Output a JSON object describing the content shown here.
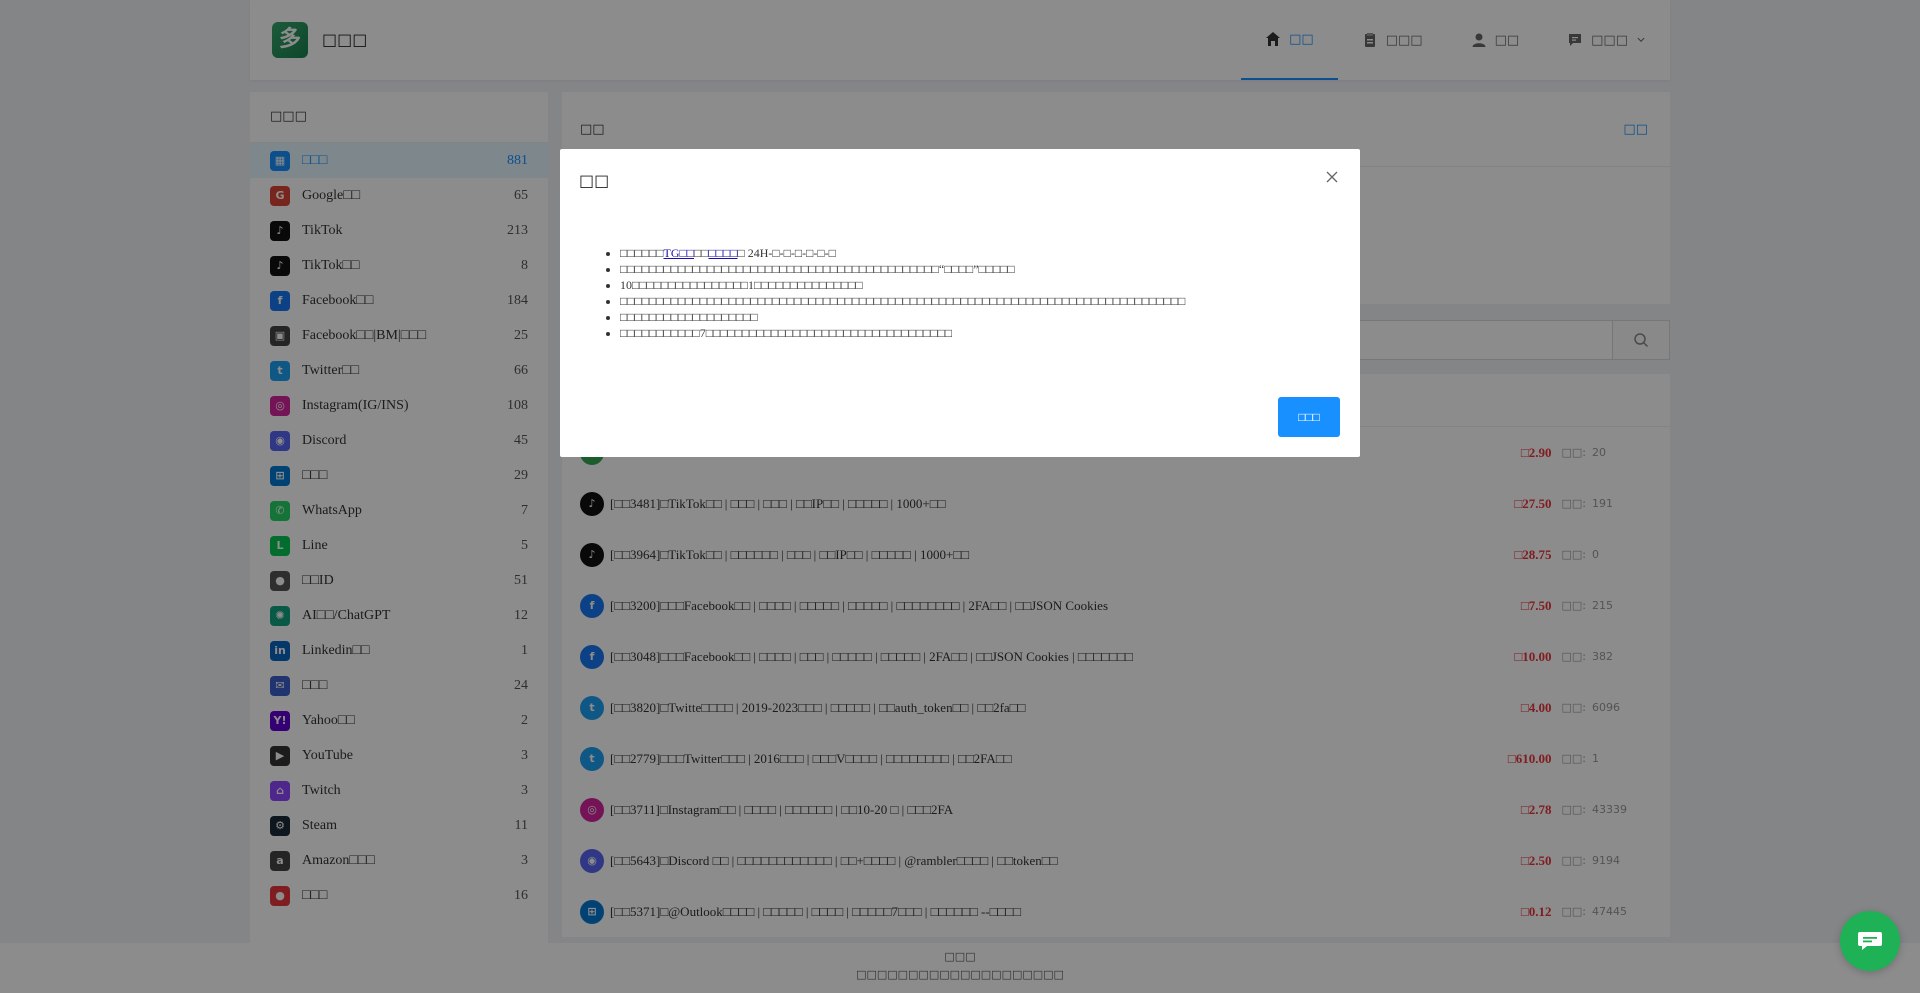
{
  "site": {
    "name": "□□□",
    "logo_char": "多"
  },
  "nav": [
    {
      "label": "□□",
      "icon": "home-icon",
      "active": true
    },
    {
      "label": "□□□",
      "icon": "clipboard-icon",
      "active": false
    },
    {
      "label": "□□",
      "icon": "user-icon",
      "active": false
    },
    {
      "label": "□□□",
      "icon": "chat-icon",
      "active": false,
      "dropdown": true
    }
  ],
  "sidebar": {
    "title": "□□□",
    "items": [
      {
        "label": "□□□",
        "count": "881",
        "icon": "grid-icon",
        "color": "#1890ff",
        "active": true
      },
      {
        "label": "Google□□",
        "count": "65",
        "icon": "chrome-icon",
        "color": "#db4437"
      },
      {
        "label": "TikTok",
        "count": "213",
        "icon": "tiktok-icon",
        "color": "#111111"
      },
      {
        "label": "TikTok□□",
        "count": "8",
        "icon": "tiktok-icon",
        "color": "#111111"
      },
      {
        "label": "Facebook□□",
        "count": "184",
        "icon": "facebook-icon",
        "color": "#1877f2"
      },
      {
        "label": "Facebook□□|BM|□□□",
        "count": "25",
        "icon": "image-icon",
        "color": "#444444"
      },
      {
        "label": "Twitter□□",
        "count": "66",
        "icon": "twitter-icon",
        "color": "#1da1f2"
      },
      {
        "label": "Instagram(IG/INS)",
        "count": "108",
        "icon": "instagram-icon",
        "color": "#d6249f"
      },
      {
        "label": "Discord",
        "count": "45",
        "icon": "discord-icon",
        "color": "#5865f2"
      },
      {
        "label": "□□□",
        "count": "29",
        "icon": "windows-icon",
        "color": "#0078d4"
      },
      {
        "label": "WhatsApp",
        "count": "7",
        "icon": "whatsapp-icon",
        "color": "#25d366"
      },
      {
        "label": "Line",
        "count": "5",
        "icon": "line-icon",
        "color": "#06c755"
      },
      {
        "label": "□□ID",
        "count": "51",
        "icon": "apple-icon",
        "color": "#555555"
      },
      {
        "label": "AI□□/ChatGPT",
        "count": "12",
        "icon": "openai-icon",
        "color": "#10a37f"
      },
      {
        "label": "Linkedin□□",
        "count": "1",
        "icon": "linkedin-icon",
        "color": "#0a66c2"
      },
      {
        "label": "□□□",
        "count": "24",
        "icon": "mail-icon",
        "color": "#3b5fcc"
      },
      {
        "label": "Yahoo□□",
        "count": "2",
        "icon": "yahoo-icon",
        "color": "#6001d2"
      },
      {
        "label": "YouTube",
        "count": "3",
        "icon": "youtube-icon",
        "color": "#333333"
      },
      {
        "label": "Twitch",
        "count": "3",
        "icon": "twitch-icon",
        "color": "#9146ff"
      },
      {
        "label": "Steam",
        "count": "11",
        "icon": "steam-icon",
        "color": "#1b2838"
      },
      {
        "label": "Amazon□□□",
        "count": "3",
        "icon": "amazon-icon",
        "color": "#444444"
      },
      {
        "label": "□□□",
        "count": "16",
        "icon": "person-icon",
        "color": "#e8353d"
      }
    ]
  },
  "notice": {
    "title": "□□",
    "more": "□□"
  },
  "search": {
    "placeholder": ""
  },
  "products": [
    {
      "name": "",
      "price": "□2.90",
      "stock_label": "□□:",
      "stock": "20",
      "icon": "chrome-icon",
      "color": "#34a853"
    },
    {
      "name": "[□□3481]□TikTok□□ | □□□ | □□□ | □□IP□□ | □□□□□ | 1000+□□",
      "price": "□27.50",
      "stock_label": "□□:",
      "stock": "191",
      "icon": "tiktok-icon",
      "color": "#111111"
    },
    {
      "name": "[□□3964]□TikTok□□ | □□□□□□ | □□□ | □□IP□□ | □□□□□ | 1000+□□",
      "price": "□28.75",
      "stock_label": "□□:",
      "stock": "0",
      "icon": "tiktok-icon",
      "color": "#111111"
    },
    {
      "name": "[□□3200]□□□Facebook□□ | □□□□ | □□□□□ | □□□□□ | □□□□□□□□ | 2FA□□ | □□JSON Cookies",
      "price": "□7.50",
      "stock_label": "□□:",
      "stock": "215",
      "icon": "facebook-icon",
      "color": "#1877f2"
    },
    {
      "name": "[□□3048]□□□Facebook□□ | □□□□ | □□□ | □□□□□ | □□□□□ | 2FA□□ | □□JSON Cookies | □□□□□□□",
      "price": "□10.00",
      "stock_label": "□□:",
      "stock": "382",
      "icon": "facebook-icon",
      "color": "#1877f2"
    },
    {
      "name": "[□□3820]□Twitte□□□□ | 2019-2023□□□ | □□□□□ | □□auth_token□□ | □□2fa□□",
      "price": "□4.00",
      "stock_label": "□□:",
      "stock": "6096",
      "icon": "twitter-icon",
      "color": "#1da1f2"
    },
    {
      "name": "[□□2779]□□□Twitter□□□ | 2016□□□ | □□□V□□□□ | □□□□□□□□ | □□2FA□□",
      "price": "□610.00",
      "stock_label": "□□:",
      "stock": "1",
      "icon": "twitter-icon",
      "color": "#1da1f2"
    },
    {
      "name": "[□□3711]□Instagram□□ | □□□□ | □□□□□□ | □□10-20 □ | □□□2FA",
      "price": "□2.78",
      "stock_label": "□□:",
      "stock": "43339",
      "icon": "instagram-icon",
      "color": "#d6249f"
    },
    {
      "name": "[□□5643]□Discord □□ | □□□□□□□□□□□□ | □□+□□□□ | @rambler□□□□ | □□token□□",
      "price": "□2.50",
      "stock_label": "□□:",
      "stock": "9194",
      "icon": "discord-icon",
      "color": "#5865f2"
    },
    {
      "name": "[□□5371]□@Outlook□□□□ | □□□□□ | □□□□ | □□□□□7□□□ | □□□□□□ --□□□□",
      "price": "□0.12",
      "stock_label": "□□:",
      "stock": "47445",
      "icon": "windows-icon",
      "color": "#0078d4"
    }
  ],
  "footer": {
    "line1": "□□□",
    "line2": "□□□□□□□□□□□□□□□□□□□□"
  },
  "modal": {
    "title": "□□",
    "line1_prefix": "□□□□□□",
    "line1_link1": "TG□□",
    "line1_mid": "□□",
    "line1_link2": "□□□□",
    "line1_suffix": "□ 24H-□-□-□-□-□-□",
    "lines": [
      "□□□□□□□□□□□□□□□□□□□□□□□□□□□□□□□□□□□□□□□□□□□□“□□□□”□□□□□",
      "10□□□□□□□□□□□□□□□□1□□□□□□□□□□□□□□□",
      "□□□□□□□□□□□□□□□□□□□□□□□□□□□□□□□□□□□□□□□□□□□□□□□□□□□□□□□□□□□□□□□□□□□□□□□□□□□□□□",
      "□□□□□□□□□□□□□□□□□□□",
      "□□□□□□□□□□□7□□□□□□□□□□□□□□□□□□□□□□□□□□□□□□□□□□"
    ],
    "ok_label": "□□□"
  },
  "colors": {
    "accent": "#1890ff",
    "price": "#e8353d",
    "chat": "#1fb156"
  }
}
